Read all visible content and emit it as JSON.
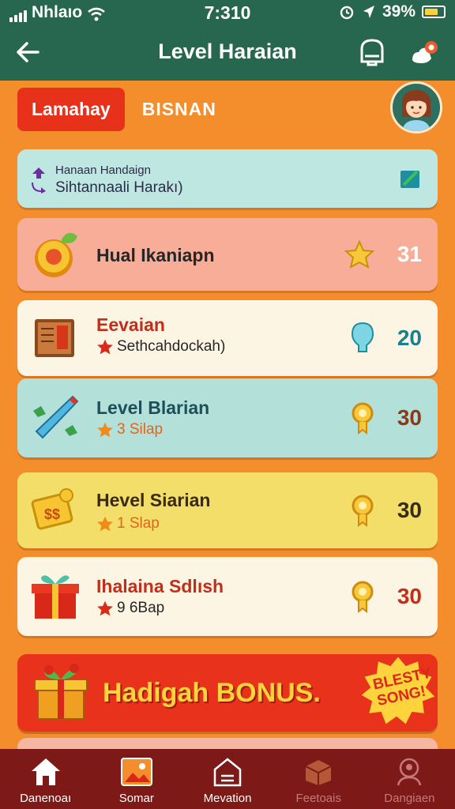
{
  "status_bar": {
    "carrier": "Nhlaıo",
    "time": "7:310",
    "battery": "39%"
  },
  "header": {
    "title": "Level Haraian"
  },
  "tabs": {
    "active": "Lamahay",
    "inactive": "BISNAN"
  },
  "info_card": {
    "line1": "Hanaan Handaign",
    "line2": "Sihtannaali Harakı)"
  },
  "items": [
    {
      "name": "Hual Ikaniapn",
      "sub": "",
      "value": "31",
      "icon": "coin-icon",
      "right_icon": "star-icon"
    },
    {
      "name": "Eevaian",
      "sub": "Sethcahdockah)",
      "value": "20",
      "icon": "book-icon",
      "right_icon": "bulb-icon"
    },
    {
      "name": "Level Blarian",
      "sub": "3 Silap",
      "value": "30",
      "icon": "rocket-icon",
      "right_icon": "medal-icon"
    },
    {
      "name": "Hevel Siarian",
      "sub": "1 Slap",
      "value": "30",
      "icon": "money-icon",
      "right_icon": "medal-icon"
    },
    {
      "name": "Ihalaina Sdlısh",
      "sub": "9 6Bap",
      "value": "30",
      "icon": "gift-icon",
      "right_icon": "medal-icon"
    }
  ],
  "bonus": {
    "text": "Hadigah BONUS.",
    "badge": "BLESTY SONG!"
  },
  "nav": [
    {
      "label": "Danenoaı",
      "icon": "home-icon"
    },
    {
      "label": "Somar",
      "icon": "image-icon"
    },
    {
      "label": "Mevation",
      "icon": "house-icon"
    },
    {
      "label": "Feetoais",
      "icon": "box-icon"
    },
    {
      "label": "Dangiaen",
      "icon": "user-icon"
    }
  ],
  "colors": {
    "header": "#27664f",
    "background": "#f48e2c",
    "accent": "#e8311a",
    "nav": "#7d1a17"
  }
}
